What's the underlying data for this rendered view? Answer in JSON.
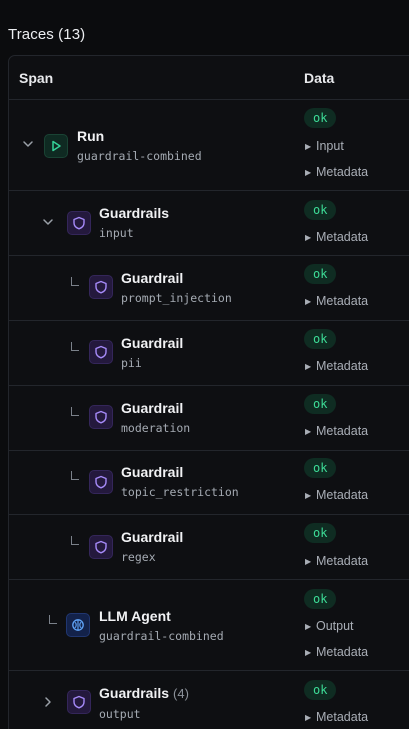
{
  "header": {
    "title": "Traces (13)"
  },
  "columns": {
    "span": "Span",
    "data": "Data"
  },
  "rows": [
    {
      "name": "Run",
      "sub": "guardrail-combined",
      "status": "ok",
      "expanders": [
        "Input",
        "Metadata"
      ],
      "icon": "play-icon",
      "toggle": "chevron-down-icon"
    },
    {
      "name": "Guardrails",
      "sub": "input",
      "status": "ok",
      "expanders": [
        "Metadata"
      ],
      "icon": "shield-icon",
      "toggle": "chevron-down-icon"
    },
    {
      "name": "Guardrail",
      "sub": "prompt_injection",
      "status": "ok",
      "expanders": [
        "Metadata"
      ],
      "icon": "shield-icon"
    },
    {
      "name": "Guardrail",
      "sub": "pii",
      "status": "ok",
      "expanders": [
        "Metadata"
      ],
      "icon": "shield-icon"
    },
    {
      "name": "Guardrail",
      "sub": "moderation",
      "status": "ok",
      "expanders": [
        "Metadata"
      ],
      "icon": "shield-icon"
    },
    {
      "name": "Guardrail",
      "sub": "topic_restriction",
      "status": "ok",
      "expanders": [
        "Metadata"
      ],
      "icon": "shield-icon"
    },
    {
      "name": "Guardrail",
      "sub": "regex",
      "status": "ok",
      "expanders": [
        "Metadata"
      ],
      "icon": "shield-icon"
    },
    {
      "name": "LLM Agent",
      "sub": "guardrail-combined",
      "status": "ok",
      "expanders": [
        "Output",
        "Metadata"
      ],
      "icon": "brain-icon"
    },
    {
      "name": "Guardrails",
      "count": "(4)",
      "sub": "output",
      "status": "ok",
      "expanders": [
        "Metadata"
      ],
      "icon": "shield-icon",
      "toggle": "chevron-right-icon"
    }
  ],
  "colors": {
    "ok_text": "#3ddc97",
    "ok_bg": "#0f2c22",
    "run_icon": "#34d399",
    "shield_icon": "#a78bfa",
    "llm_icon": "#60a5fa"
  }
}
